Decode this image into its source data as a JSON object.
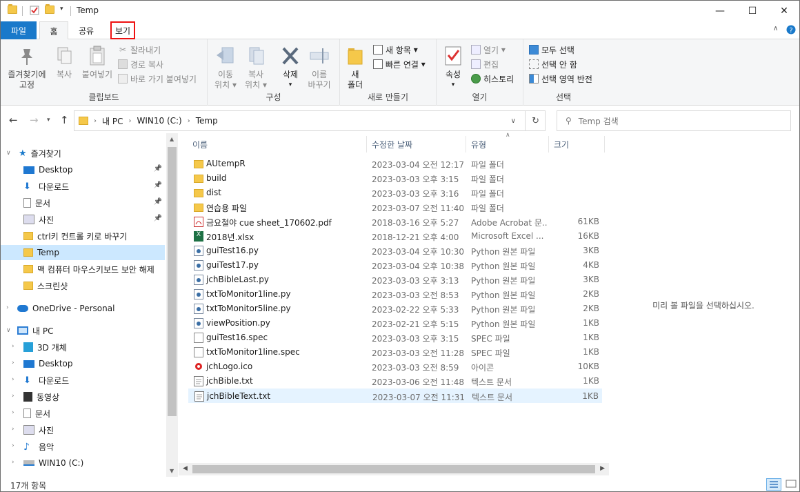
{
  "window": {
    "title": "Temp",
    "minimize": "—",
    "maximize": "☐",
    "close": "✕"
  },
  "tabs": {
    "file": "파일",
    "home": "홈",
    "share": "공유",
    "view": "보기"
  },
  "ribbon": {
    "clipboard": {
      "label": "클립보드",
      "pin": "즐겨찾기에\n고정",
      "pin1": "즐겨찾기에",
      "pin2": "고정",
      "copy": "복사",
      "paste": "붙여넣기",
      "cut": "잘라내기",
      "copy_path": "경로 복사",
      "paste_shortcut": "바로 가기 붙여넣기"
    },
    "organize": {
      "label": "구성",
      "move1": "이동",
      "move2": "위치",
      "copy1": "복사",
      "copy2": "위치",
      "delete": "삭제",
      "rename1": "이름",
      "rename2": "바꾸기"
    },
    "new": {
      "label": "새로 만들기",
      "folder1": "새",
      "folder2": "폴더",
      "new_item": "새 항목",
      "easy_access": "빠른 연결"
    },
    "open": {
      "label": "열기",
      "properties": "속성",
      "open": "열기",
      "edit": "편집",
      "history": "히스토리"
    },
    "select": {
      "label": "선택",
      "select_all": "모두 선택",
      "select_none": "선택 안 함",
      "invert": "선택 영역 반전"
    }
  },
  "address": {
    "crumbs": [
      "내 PC",
      "WIN10 (C:)",
      "Temp"
    ],
    "search_placeholder": "Temp 검색"
  },
  "nav": {
    "quick_access": "즐겨찾기",
    "quick_items": [
      "Desktop",
      "다운로드",
      "문서",
      "사진",
      "ctrl키 컨트롤 키로 바꾸기",
      "Temp",
      "맥 컴퓨터 마우스키보드 보안 해제",
      "스크린샷"
    ],
    "onedrive": "OneDrive - Personal",
    "this_pc": "내 PC",
    "pc_items": [
      "3D 개체",
      "Desktop",
      "다운로드",
      "동영상",
      "문서",
      "사진",
      "음악",
      "WIN10 (C:)"
    ]
  },
  "columns": {
    "name": "이름",
    "date": "수정한 날짜",
    "type": "유형",
    "size": "크기"
  },
  "files": [
    {
      "name": "AUtempR",
      "date": "2023-03-04 오전 12:17",
      "type": "파일 폴더",
      "size": "",
      "icon": "folder-icon"
    },
    {
      "name": "build",
      "date": "2023-03-03 오후 3:15",
      "type": "파일 폴더",
      "size": "",
      "icon": "folder-icon"
    },
    {
      "name": "dist",
      "date": "2023-03-03 오후 3:16",
      "type": "파일 폴더",
      "size": "",
      "icon": "folder-icon"
    },
    {
      "name": "연습용 파일",
      "date": "2023-03-07 오전 11:40",
      "type": "파일 폴더",
      "size": "",
      "icon": "folder-icon"
    },
    {
      "name": "금요철야 cue sheet_170602.pdf",
      "date": "2018-03-16 오후 5:27",
      "type": "Adobe Acrobat 문...",
      "size": "61KB",
      "icon": "pdf-icon"
    },
    {
      "name": "2018년.xlsx",
      "date": "2018-12-21 오후 4:00",
      "type": "Microsoft Excel ...",
      "size": "16KB",
      "icon": "excel-icon"
    },
    {
      "name": "guiTest16.py",
      "date": "2023-03-04 오후 10:30",
      "type": "Python 원본 파일",
      "size": "3KB",
      "icon": "python-file-icon"
    },
    {
      "name": "guiTest17.py",
      "date": "2023-03-04 오후 10:38",
      "type": "Python 원본 파일",
      "size": "4KB",
      "icon": "python-file-icon"
    },
    {
      "name": "jchBibleLast.py",
      "date": "2023-03-03 오후 3:13",
      "type": "Python 원본 파일",
      "size": "3KB",
      "icon": "python-file-icon"
    },
    {
      "name": "txtToMonitor1line.py",
      "date": "2023-03-03 오전 8:53",
      "type": "Python 원본 파일",
      "size": "2KB",
      "icon": "python-file-icon"
    },
    {
      "name": "txtToMonitor5line.py",
      "date": "2023-02-22 오후 5:33",
      "type": "Python 원본 파일",
      "size": "2KB",
      "icon": "python-file-icon"
    },
    {
      "name": "viewPosition.py",
      "date": "2023-02-21 오후 5:15",
      "type": "Python 원본 파일",
      "size": "1KB",
      "icon": "python-file-icon"
    },
    {
      "name": "guiTest16.spec",
      "date": "2023-03-03 오후 3:15",
      "type": "SPEC 파일",
      "size": "1KB",
      "icon": "blank-file-icon"
    },
    {
      "name": "txtToMonitor1line.spec",
      "date": "2023-03-03 오전 11:28",
      "type": "SPEC 파일",
      "size": "1KB",
      "icon": "blank-file-icon"
    },
    {
      "name": "jchLogo.ico",
      "date": "2023-03-03 오전 8:59",
      "type": "아이콘",
      "size": "10KB",
      "icon": "logo-icon"
    },
    {
      "name": "jchBible.txt",
      "date": "2023-03-06 오전 11:48",
      "type": "텍스트 문서",
      "size": "1KB",
      "icon": "text-file-icon"
    },
    {
      "name": "jchBibleText.txt",
      "date": "2023-03-07 오전 11:31",
      "type": "텍스트 문서",
      "size": "1KB",
      "icon": "text-file-icon"
    }
  ],
  "preview": "미리 볼 파일을 선택하십시오.",
  "status": "17개 항목",
  "colors": {
    "accent": "#1979ca",
    "selection": "#cce8ff",
    "highlight_box": "#e11111",
    "folder": "#f5c84a"
  }
}
